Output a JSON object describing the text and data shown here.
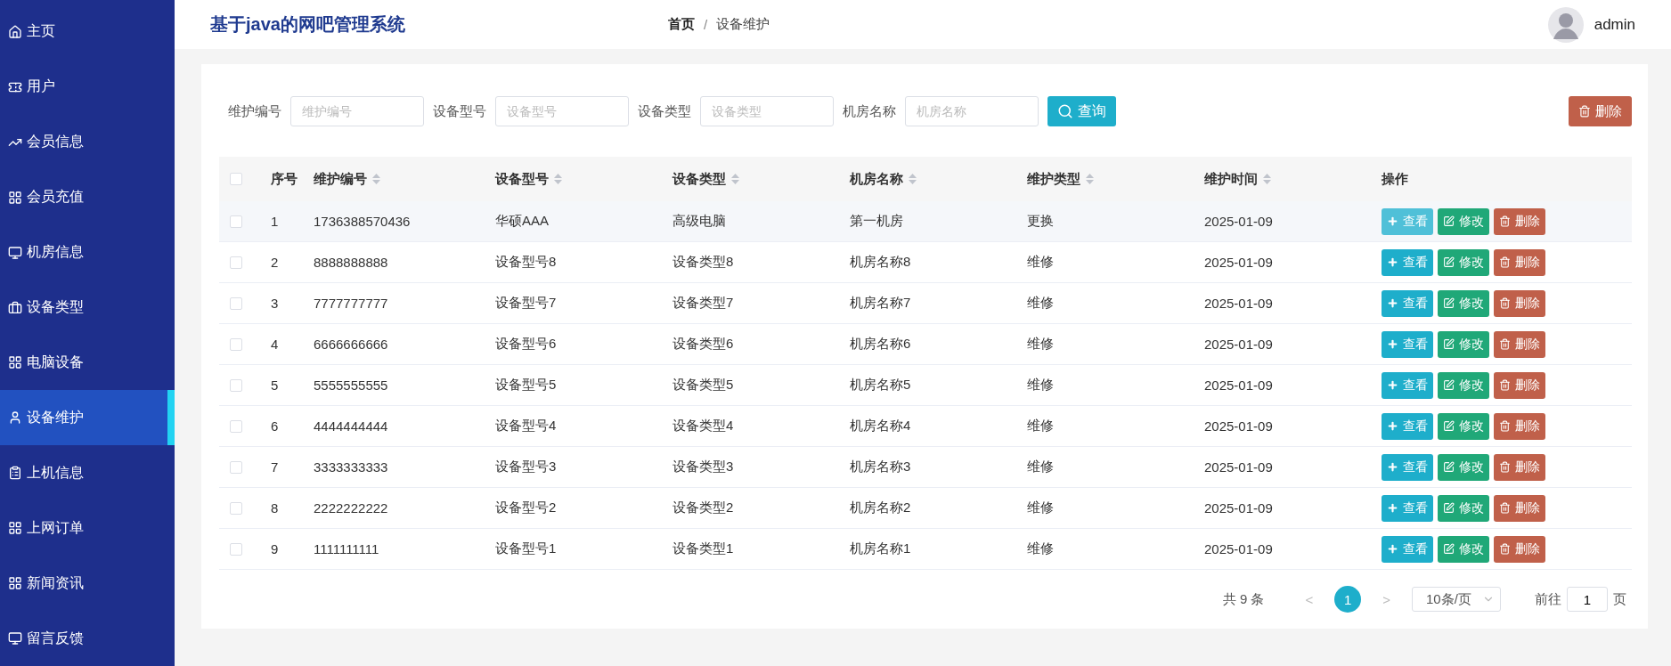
{
  "sidebar": {
    "items": [
      {
        "label": "主页",
        "selected": false
      },
      {
        "label": "用户",
        "selected": false
      },
      {
        "label": "会员信息",
        "selected": false
      },
      {
        "label": "会员充值",
        "selected": false
      },
      {
        "label": "机房信息",
        "selected": false
      },
      {
        "label": "设备类型",
        "selected": false
      },
      {
        "label": "电脑设备",
        "selected": false
      },
      {
        "label": "设备维护",
        "selected": true
      },
      {
        "label": "上机信息",
        "selected": false
      },
      {
        "label": "上网订单",
        "selected": false
      },
      {
        "label": "新闻资讯",
        "selected": false
      },
      {
        "label": "留言反馈",
        "selected": false
      }
    ]
  },
  "header": {
    "title": "基于java的网吧管理系统",
    "breadcrumb": [
      "首页",
      "设备维护"
    ],
    "separator": "/",
    "user": "admin"
  },
  "filters": [
    {
      "label": "维护编号",
      "placeholder": "维护编号"
    },
    {
      "label": "设备型号",
      "placeholder": "设备型号"
    },
    {
      "label": "设备类型",
      "placeholder": "设备类型"
    },
    {
      "label": "机房名称",
      "placeholder": "机房名称"
    }
  ],
  "search_button": "查询",
  "delete_button": "删除",
  "table": {
    "select_all_checked": false,
    "columns": [
      {
        "label": "序号",
        "sortable": false
      },
      {
        "label": "维护编号",
        "sortable": true
      },
      {
        "label": "设备型号",
        "sortable": true
      },
      {
        "label": "设备类型",
        "sortable": true
      },
      {
        "label": "机房名称",
        "sortable": true
      },
      {
        "label": "维护类型",
        "sortable": true
      },
      {
        "label": "维护时间",
        "sortable": true
      },
      {
        "label": "操作",
        "sortable": false
      }
    ],
    "rows": [
      {
        "hovered": true,
        "checked": false,
        "cells": [
          "1",
          "1736388570436",
          "华硕AAA",
          "高级电脑",
          "第一机房",
          "更换",
          "2025-01-09"
        ],
        "actions": [
          "查看",
          "修改",
          "删除"
        ]
      },
      {
        "hovered": false,
        "checked": false,
        "cells": [
          "2",
          "8888888888",
          "设备型号8",
          "设备类型8",
          "机房名称8",
          "维修",
          "2025-01-09"
        ],
        "actions": [
          "查看",
          "修改",
          "删除"
        ]
      },
      {
        "hovered": false,
        "checked": false,
        "cells": [
          "3",
          "7777777777",
          "设备型号7",
          "设备类型7",
          "机房名称7",
          "维修",
          "2025-01-09"
        ],
        "actions": [
          "查看",
          "修改",
          "删除"
        ]
      },
      {
        "hovered": false,
        "checked": false,
        "cells": [
          "4",
          "6666666666",
          "设备型号6",
          "设备类型6",
          "机房名称6",
          "维修",
          "2025-01-09"
        ],
        "actions": [
          "查看",
          "修改",
          "删除"
        ]
      },
      {
        "hovered": false,
        "checked": false,
        "cells": [
          "5",
          "5555555555",
          "设备型号5",
          "设备类型5",
          "机房名称5",
          "维修",
          "2025-01-09"
        ],
        "actions": [
          "查看",
          "修改",
          "删除"
        ]
      },
      {
        "hovered": false,
        "checked": false,
        "cells": [
          "6",
          "4444444444",
          "设备型号4",
          "设备类型4",
          "机房名称4",
          "维修",
          "2025-01-09"
        ],
        "actions": [
          "查看",
          "修改",
          "删除"
        ]
      },
      {
        "hovered": false,
        "checked": false,
        "cells": [
          "7",
          "3333333333",
          "设备型号3",
          "设备类型3",
          "机房名称3",
          "维修",
          "2025-01-09"
        ],
        "actions": [
          "查看",
          "修改",
          "删除"
        ]
      },
      {
        "hovered": false,
        "checked": false,
        "cells": [
          "8",
          "2222222222",
          "设备型号2",
          "设备类型2",
          "机房名称2",
          "维修",
          "2025-01-09"
        ],
        "actions": [
          "查看",
          "修改",
          "删除"
        ]
      },
      {
        "hovered": false,
        "checked": false,
        "cells": [
          "9",
          "1111111111",
          "设备型号1",
          "设备类型1",
          "机房名称1",
          "维修",
          "2025-01-09"
        ],
        "actions": [
          "查看",
          "修改",
          "删除"
        ]
      }
    ]
  },
  "pagination": {
    "total": "共 9 条",
    "prev": "<",
    "pages": [
      {
        "label": "1",
        "selected": true
      }
    ],
    "next": ">",
    "page_size": "10条/页",
    "goto_label": "前往",
    "goto_value": "1",
    "goto_suffix": "页"
  }
}
